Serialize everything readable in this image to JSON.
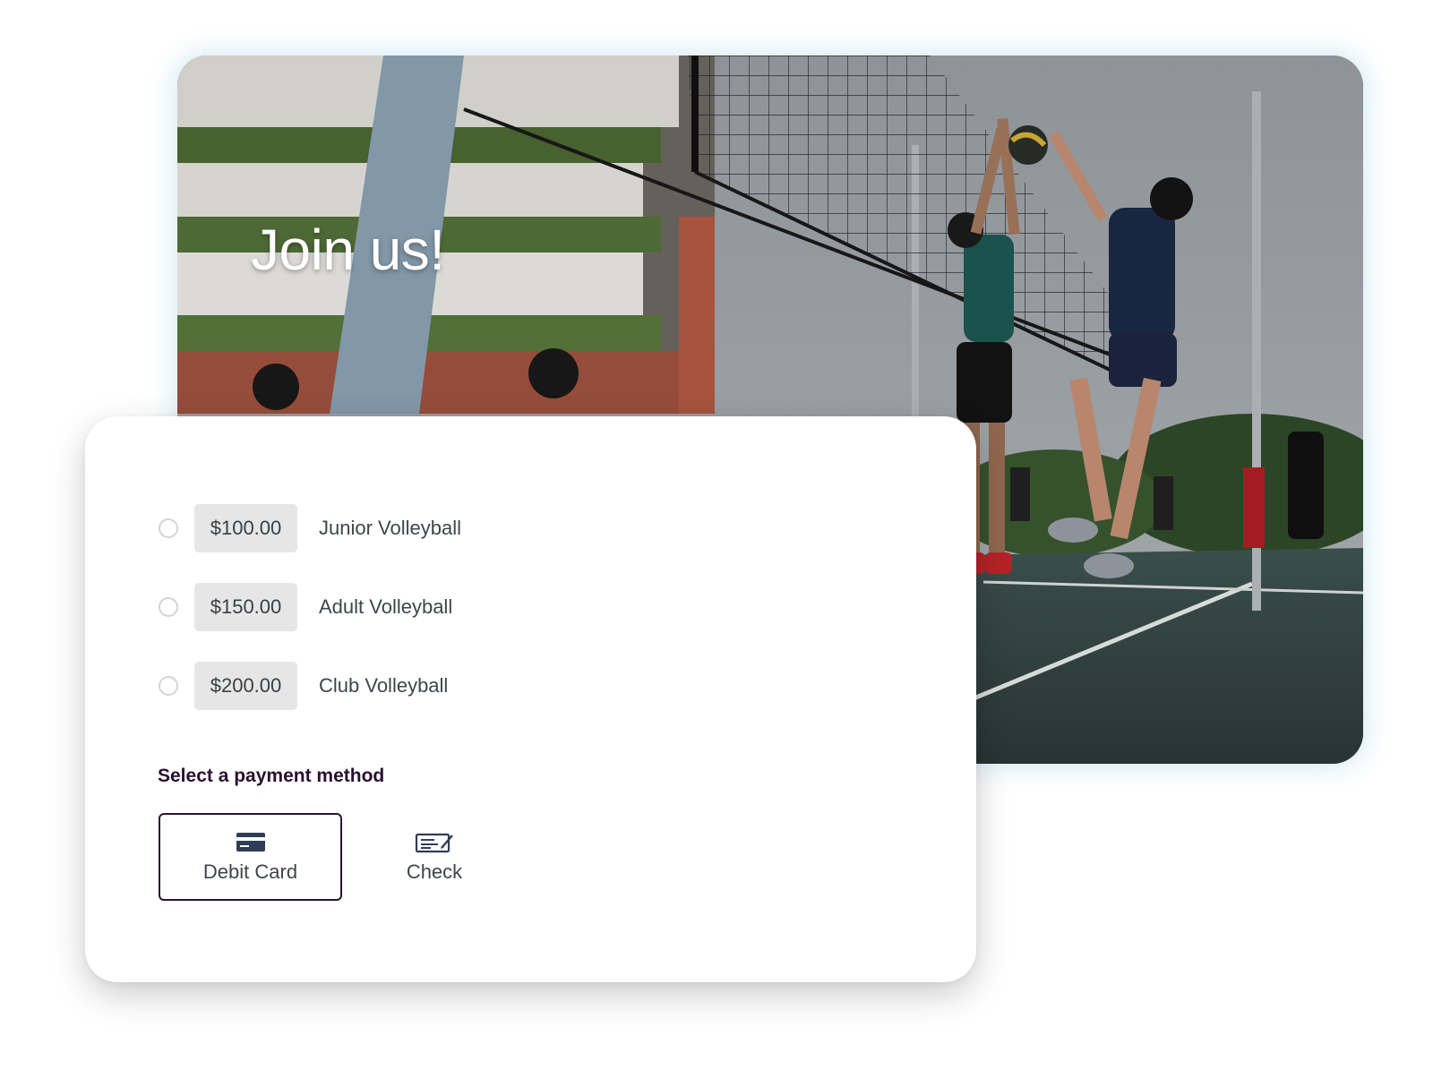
{
  "hero": {
    "title": "Join us!"
  },
  "membership_options": [
    {
      "price": "$100.00",
      "label": "Junior Volleyball",
      "selected": false
    },
    {
      "price": "$150.00",
      "label": "Adult Volleyball",
      "selected": false
    },
    {
      "price": "$200.00",
      "label": "Club Volleyball",
      "selected": false
    }
  ],
  "payment": {
    "heading": "Select a payment method",
    "methods": [
      {
        "label": "Debit Card",
        "icon": "credit-card-icon",
        "selected": true
      },
      {
        "label": "Check",
        "icon": "check-icon",
        "selected": false
      }
    ]
  },
  "colors": {
    "accent": "#2e1433",
    "heading": "#2a0f30",
    "price_tag_bg": "#e6e6e6",
    "text": "#3f454b",
    "icon": "#2f3e56"
  }
}
